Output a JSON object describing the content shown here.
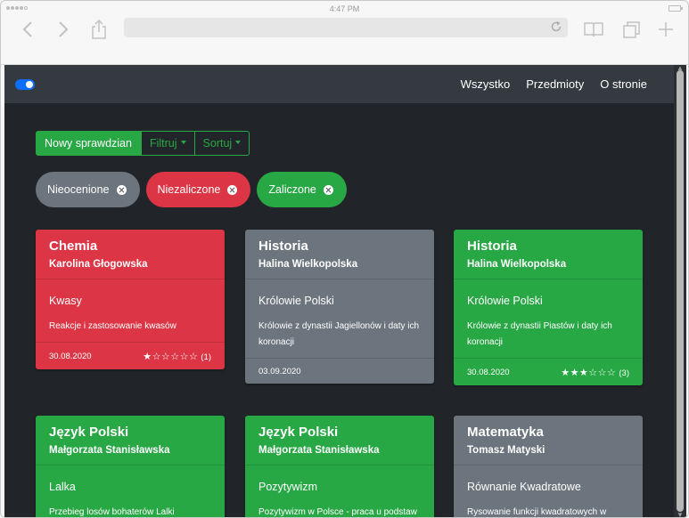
{
  "status_bar": {
    "time": "4:47 PM"
  },
  "navbar": {
    "links": [
      "Wszystko",
      "Przedmioty",
      "O stronie"
    ]
  },
  "actions": {
    "new_test": "Nowy sprawdzian",
    "filter": "Filtruj",
    "sort": "Sortuj"
  },
  "filters": [
    {
      "label": "Nieocenione",
      "color": "#6c757d"
    },
    {
      "label": "Niezaliczone",
      "color": "#dc3545"
    },
    {
      "label": "Zaliczone",
      "color": "#28a745"
    }
  ],
  "cards": [
    {
      "subject": "Chemia",
      "teacher": "Karolina Głogowska",
      "topic": "Kwasy",
      "description": "Reakcje i zastosowanie kwasów",
      "date": "30.08.2020",
      "rating": 1,
      "count": "(1)",
      "color": "#dc3545"
    },
    {
      "subject": "Historia",
      "teacher": "Halina Wielkopolska",
      "topic": "Królowie Polski",
      "description": "Królowie z dynastii Jagiellonów i daty ich koronacji",
      "date": "03.09.2020",
      "rating": null,
      "count": "",
      "color": "#6c757d"
    },
    {
      "subject": "Historia",
      "teacher": "Halina Wielkopolska",
      "topic": "Królowie Polski",
      "description": "Królowie z dynastii Piastów i daty ich koronacji",
      "date": "30.08.2020",
      "rating": 3,
      "count": "(3)",
      "color": "#28a745"
    },
    {
      "subject": "Język Polski",
      "teacher": "Małgorzata Stanisławska",
      "topic": "Lalka",
      "description": "Przebieg losów bohaterów Lalki Bolesława",
      "date": "",
      "rating": null,
      "count": "",
      "color": "#28a745"
    },
    {
      "subject": "Język Polski",
      "teacher": "Małgorzata Stanisławska",
      "topic": "Pozytywizm",
      "description": "Pozytywizm w Polsce - praca u podstaw i",
      "date": "",
      "rating": null,
      "count": "",
      "color": "#28a745"
    },
    {
      "subject": "Matematyka",
      "teacher": "Tomasz Matyski",
      "topic": "Równanie Kwadratowe",
      "description": "Rysowanie funkcji kwadratowych w",
      "date": "",
      "rating": null,
      "count": "",
      "color": "#6c757d"
    }
  ]
}
